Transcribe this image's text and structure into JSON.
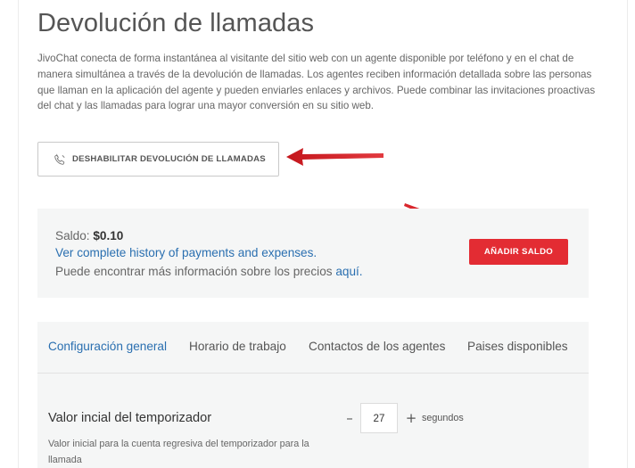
{
  "page": {
    "title": "Devolución de llamadas",
    "description": "JivoChat conecta de forma instantánea al visitante del sitio web con un agente disponible por teléfono y en el chat de manera simultánea a través de la devolución de llamadas. Los agentes reciben información detallada sobre las personas que llaman en la aplicación del agente y pueden enviarles enlaces y archivos. Puede combinar las invitaciones proactivas del chat y las llamadas para lograr una mayor conversión en su sitio web."
  },
  "disable_button": {
    "label": "DESHABILITAR DEVOLUCIÓN DE LLAMADAS",
    "icon": "phone-icon"
  },
  "balance": {
    "label": "Saldo:",
    "amount": "$0.10",
    "history_prefix": "Ver ",
    "history_link": "complete history of payments and expenses.",
    "pricing_text": "Puede encontrar más información sobre los precios ",
    "pricing_link": "aquí.",
    "add_button": "AÑADIR SALDO"
  },
  "tabs": [
    {
      "label": "Configuración general",
      "active": true
    },
    {
      "label": "Horario de trabajo",
      "active": false
    },
    {
      "label": "Contactos de los agentes",
      "active": false
    },
    {
      "label": "Paises disponibles",
      "active": false
    }
  ],
  "timer_setting": {
    "label": "Valor incial del temporizador",
    "help": "Valor inicial para la cuenta regresiva del temporizador para la llamada",
    "value": "27",
    "decrement": "–",
    "increment": "+",
    "unit": "segundos"
  },
  "colors": {
    "accent_red": "#e32c33",
    "link_blue": "#2a6fb0",
    "panel_bg": "#f5f6f6"
  }
}
